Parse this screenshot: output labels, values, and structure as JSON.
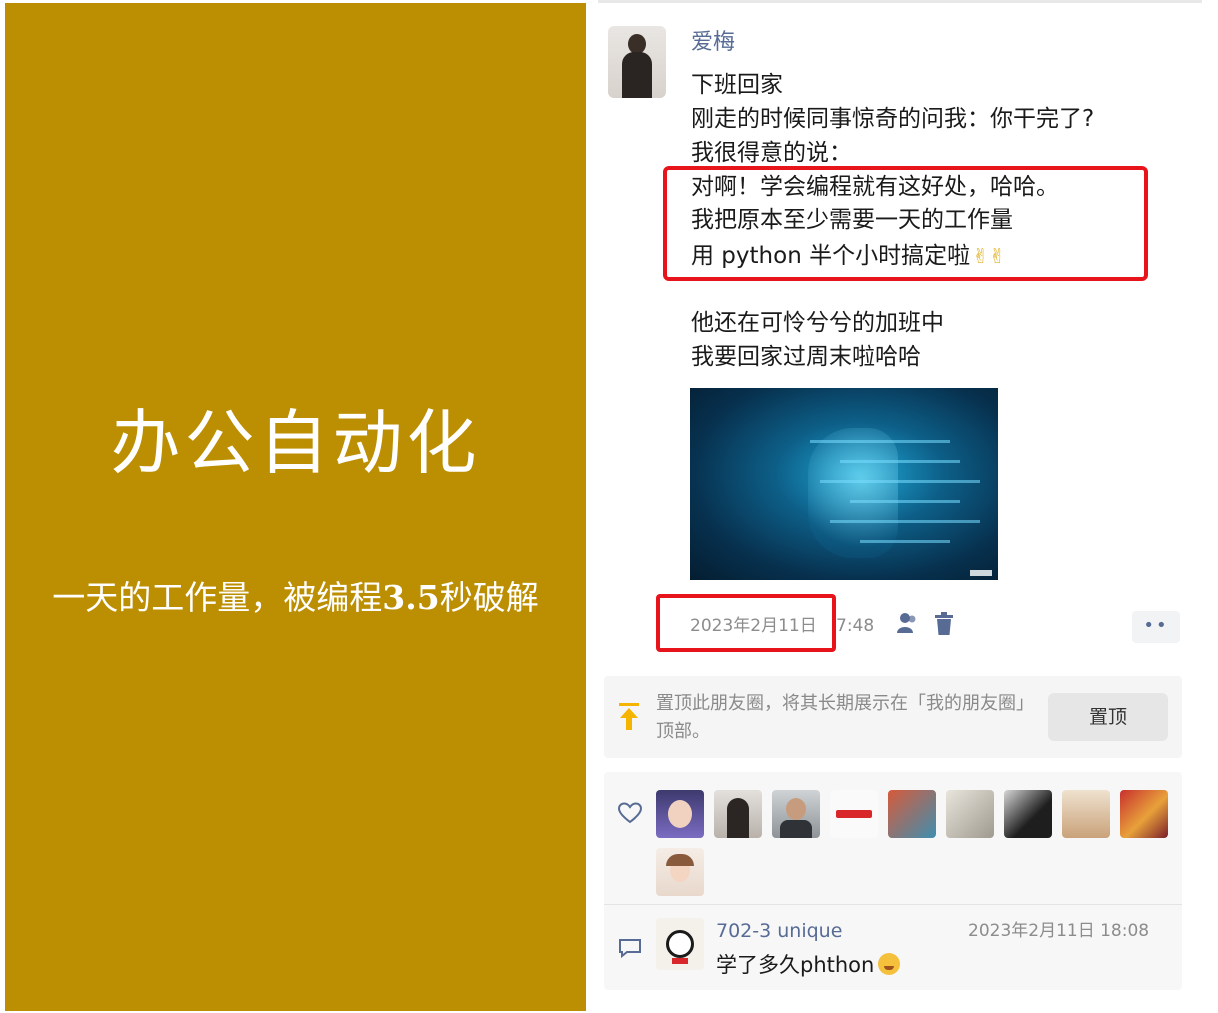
{
  "slide": {
    "title": "办公自动化",
    "subtitle_prefix": "一天的工作量，被编程",
    "subtitle_bold": "3.5",
    "subtitle_suffix": "秒破解",
    "background_color": "#bc8e02"
  },
  "post": {
    "author": "爱梅",
    "lines": [
      "下班回家",
      "刚走的时候同事惊奇的问我：你干完了?",
      "我很得意的说：",
      "对啊！学会编程就有这好处，哈哈。",
      "我把原本至少需要一天的工作量",
      "用 python 半个小时搞定啦",
      "他还在可怜兮兮的加班中",
      "我要回家过周末啦哈哈"
    ],
    "date": "2023年2月11日",
    "time": "7:48",
    "more_label": "••",
    "highlight_color": "#e8141c"
  },
  "pin": {
    "text": "置顶此朋友圈，将其长期展示在「我的朋友圈」顶部。",
    "button_label": "置顶"
  },
  "likes": {
    "icon": "heart-icon",
    "avatars": [
      "cartoon-girl",
      "woman-glasses",
      "man-portrait",
      "brand-logo",
      "anime-scene",
      "sketch-art",
      "dark-photo",
      "food-photo",
      "colorful-art",
      "young-woman"
    ]
  },
  "comment": {
    "user": "702-3 unique",
    "time": "2023年2月11日 18:08",
    "text": "学了多久phthon",
    "emoji": "grinning-face"
  },
  "colors": {
    "link_blue": "#576b95",
    "meta_gray": "#8c8c8c"
  }
}
